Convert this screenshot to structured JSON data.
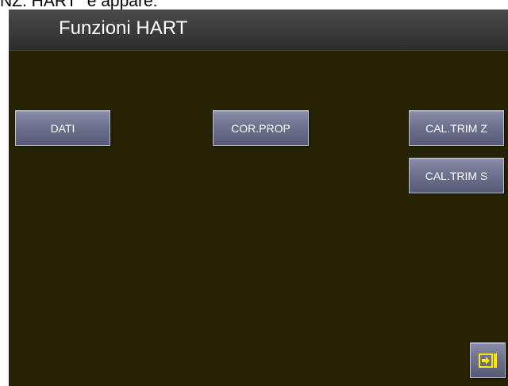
{
  "caption": {
    "text": "NZ. HART\" e appare:"
  },
  "header": {
    "title": "Funzioni HART"
  },
  "buttons": {
    "dati": "DATI",
    "cor_prop": "COR.PROP",
    "cal_trim_z": "CAL.TRIM Z",
    "cal_trim_s": "CAL.TRIM S"
  },
  "exit_button": {
    "icon": "exit-arrow-icon"
  },
  "colors": {
    "screen_background": "#262204",
    "title_bar": "#3a3a3a",
    "button": "#6e7290",
    "exit_icon": "#ffe600"
  }
}
